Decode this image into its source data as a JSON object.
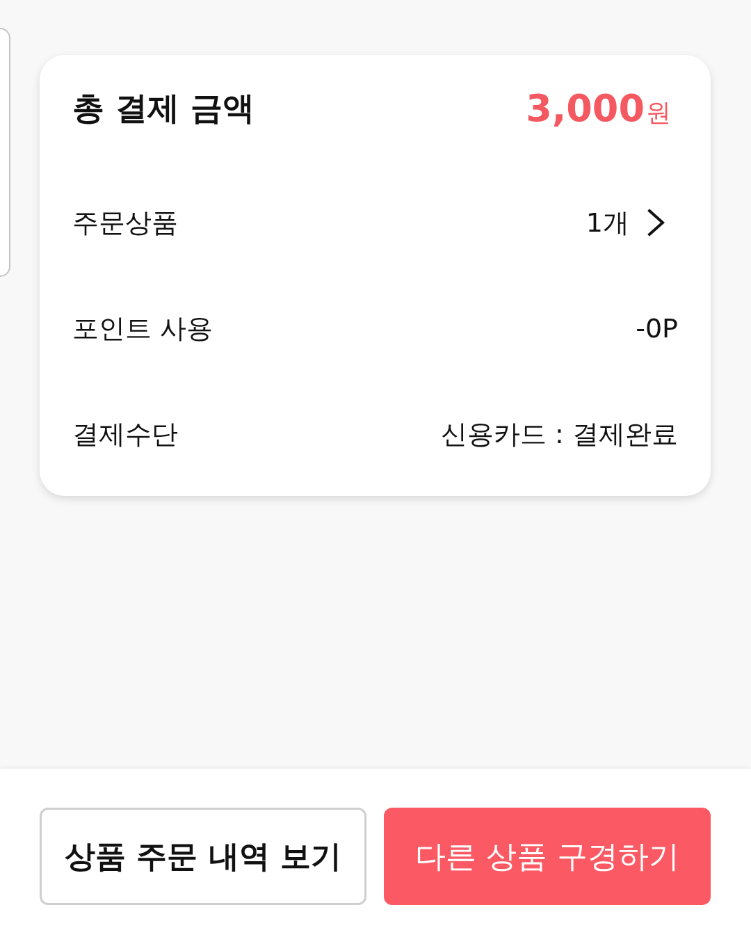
{
  "summary": {
    "title": "총 결제 금액",
    "amount": "3,000",
    "currency": "원",
    "rows": [
      {
        "kind": "link",
        "label": "주문상품",
        "value": "1개"
      },
      {
        "kind": "plain",
        "label": "포인트 사용",
        "value": "-0P"
      },
      {
        "kind": "plain",
        "label": "결제수단",
        "value": "신용카드 : 결제완료"
      }
    ]
  },
  "buttons": [
    {
      "kind": "outline",
      "label": "상품 주문 내역 보기"
    },
    {
      "kind": "primary",
      "label": "다른 상품 구경하기"
    }
  ]
}
